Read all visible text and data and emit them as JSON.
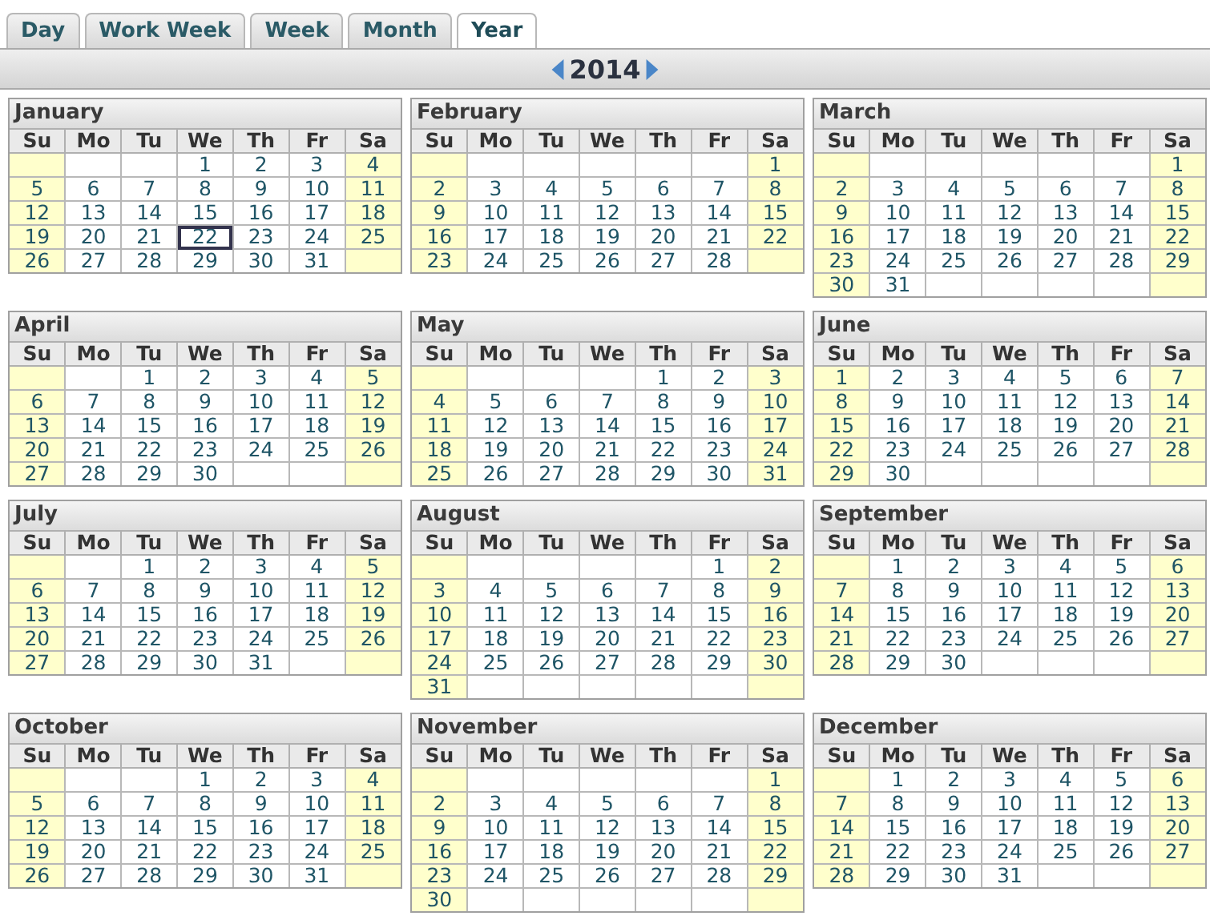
{
  "tabs": [
    {
      "label": "Day",
      "selected": false
    },
    {
      "label": "Work Week",
      "selected": false
    },
    {
      "label": "Week",
      "selected": false
    },
    {
      "label": "Month",
      "selected": false
    },
    {
      "label": "Year",
      "selected": true
    }
  ],
  "year": "2014",
  "months": [
    {
      "name": "January",
      "weekdays": [
        "Su",
        "Mo",
        "Tu",
        "We",
        "Th",
        "Fr",
        "Sa"
      ],
      "weeks": [
        [
          "1",
          "2",
          "3",
          "4"
        ],
        [
          "5",
          "6",
          "7",
          "8",
          "9",
          "10",
          "11"
        ],
        [
          "12",
          "13",
          "14",
          "15",
          "16",
          "17",
          "18"
        ],
        [
          "19",
          "20",
          "21",
          {
            "day": "22",
            "today": true
          },
          "23",
          "24",
          "25"
        ],
        [
          "26",
          "27",
          "28",
          "29",
          "30",
          "31"
        ]
      ]
    },
    {
      "name": "February",
      "weekdays": [
        "Su",
        "Mo",
        "Tu",
        "We",
        "Th",
        "Fr",
        "Sa"
      ],
      "weeks": [
        [
          "1"
        ],
        [
          "2",
          "3",
          "4",
          "5",
          "6",
          "7",
          "8"
        ],
        [
          "9",
          "10",
          "11",
          "12",
          "13",
          "14",
          "15"
        ],
        [
          "16",
          "17",
          "18",
          "19",
          "20",
          "21",
          "22"
        ],
        [
          "23",
          "24",
          "25",
          "26",
          "27",
          "28"
        ]
      ]
    },
    {
      "name": "March",
      "weekdays": [
        "Su",
        "Mo",
        "Tu",
        "We",
        "Th",
        "Fr",
        "Sa"
      ],
      "weeks": [
        [
          "1"
        ],
        [
          "2",
          "3",
          "4",
          "5",
          "6",
          "7",
          "8"
        ],
        [
          "9",
          "10",
          "11",
          "12",
          "13",
          "14",
          "15"
        ],
        [
          "16",
          "17",
          "18",
          "19",
          "20",
          "21",
          "22"
        ],
        [
          "23",
          "24",
          "25",
          "26",
          "27",
          "28",
          "29"
        ],
        [
          "30",
          "31"
        ]
      ]
    },
    {
      "name": "April",
      "weekdays": [
        "Su",
        "Mo",
        "Tu",
        "We",
        "Th",
        "Fr",
        "Sa"
      ],
      "weeks": [
        [
          "1",
          "2",
          "3",
          "4",
          "5"
        ],
        [
          "6",
          "7",
          "8",
          "9",
          "10",
          "11",
          "12"
        ],
        [
          "13",
          "14",
          "15",
          "16",
          "17",
          "18",
          "19"
        ],
        [
          "20",
          "21",
          "22",
          "23",
          "24",
          "25",
          "26"
        ],
        [
          "27",
          "28",
          "29",
          "30"
        ]
      ]
    },
    {
      "name": "May",
      "weekdays": [
        "Su",
        "Mo",
        "Tu",
        "We",
        "Th",
        "Fr",
        "Sa"
      ],
      "weeks": [
        [
          "1",
          "2",
          "3"
        ],
        [
          "4",
          "5",
          "6",
          "7",
          "8",
          "9",
          "10"
        ],
        [
          "11",
          "12",
          "13",
          "14",
          "15",
          "16",
          "17"
        ],
        [
          "18",
          "19",
          "20",
          "21",
          "22",
          "23",
          "24"
        ],
        [
          "25",
          "26",
          "27",
          "28",
          "29",
          "30",
          "31"
        ]
      ]
    },
    {
      "name": "June",
      "weekdays": [
        "Su",
        "Mo",
        "Tu",
        "We",
        "Th",
        "Fr",
        "Sa"
      ],
      "weeks": [
        [
          "1",
          "2",
          "3",
          "4",
          "5",
          "6",
          "7"
        ],
        [
          "8",
          "9",
          "10",
          "11",
          "12",
          "13",
          "14"
        ],
        [
          "15",
          "16",
          "17",
          "18",
          "19",
          "20",
          "21"
        ],
        [
          "22",
          "23",
          "24",
          "25",
          "26",
          "27",
          "28"
        ],
        [
          "29",
          "30"
        ]
      ]
    },
    {
      "name": "July",
      "weekdays": [
        "Su",
        "Mo",
        "Tu",
        "We",
        "Th",
        "Fr",
        "Sa"
      ],
      "weeks": [
        [
          "1",
          "2",
          "3",
          "4",
          "5"
        ],
        [
          "6",
          "7",
          "8",
          "9",
          "10",
          "11",
          "12"
        ],
        [
          "13",
          "14",
          "15",
          "16",
          "17",
          "18",
          "19"
        ],
        [
          "20",
          "21",
          "22",
          "23",
          "24",
          "25",
          "26"
        ],
        [
          "27",
          "28",
          "29",
          "30",
          "31"
        ]
      ]
    },
    {
      "name": "August",
      "weekdays": [
        "Su",
        "Mo",
        "Tu",
        "We",
        "Th",
        "Fr",
        "Sa"
      ],
      "weeks": [
        [
          "1",
          "2"
        ],
        [
          "3",
          "4",
          "5",
          "6",
          "7",
          "8",
          "9"
        ],
        [
          "10",
          "11",
          "12",
          "13",
          "14",
          "15",
          "16"
        ],
        [
          "17",
          "18",
          "19",
          "20",
          "21",
          "22",
          "23"
        ],
        [
          "24",
          "25",
          "26",
          "27",
          "28",
          "29",
          "30"
        ],
        [
          "31"
        ]
      ]
    },
    {
      "name": "September",
      "weekdays": [
        "Su",
        "Mo",
        "Tu",
        "We",
        "Th",
        "Fr",
        "Sa"
      ],
      "weeks": [
        [
          "1",
          "2",
          "3",
          "4",
          "5",
          "6"
        ],
        [
          "7",
          "8",
          "9",
          "10",
          "11",
          "12",
          "13"
        ],
        [
          "14",
          "15",
          "16",
          "17",
          "18",
          "19",
          "20"
        ],
        [
          "21",
          "22",
          "23",
          "24",
          "25",
          "26",
          "27"
        ],
        [
          "28",
          "29",
          "30"
        ]
      ]
    },
    {
      "name": "October",
      "weekdays": [
        "Su",
        "Mo",
        "Tu",
        "We",
        "Th",
        "Fr",
        "Sa"
      ],
      "weeks": [
        [
          "1",
          "2",
          "3",
          "4"
        ],
        [
          "5",
          "6",
          "7",
          "8",
          "9",
          "10",
          "11"
        ],
        [
          "12",
          "13",
          "14",
          "15",
          "16",
          "17",
          "18"
        ],
        [
          "19",
          "20",
          "21",
          "22",
          "23",
          "24",
          "25"
        ],
        [
          "26",
          "27",
          "28",
          "29",
          "30",
          "31"
        ]
      ]
    },
    {
      "name": "November",
      "weekdays": [
        "Su",
        "Mo",
        "Tu",
        "We",
        "Th",
        "Fr",
        "Sa"
      ],
      "weeks": [
        [
          "1"
        ],
        [
          "2",
          "3",
          "4",
          "5",
          "6",
          "7",
          "8"
        ],
        [
          "9",
          "10",
          "11",
          "12",
          "13",
          "14",
          "15"
        ],
        [
          "16",
          "17",
          "18",
          "19",
          "20",
          "21",
          "22"
        ],
        [
          "23",
          "24",
          "25",
          "26",
          "27",
          "28",
          "29"
        ],
        [
          "30"
        ]
      ]
    },
    {
      "name": "December",
      "weekdays": [
        "Su",
        "Mo",
        "Tu",
        "We",
        "Th",
        "Fr",
        "Sa"
      ],
      "weeks": [
        [
          "1",
          "2",
          "3",
          "4",
          "5",
          "6"
        ],
        [
          "7",
          "8",
          "9",
          "10",
          "11",
          "12",
          "13"
        ],
        [
          "14",
          "15",
          "16",
          "17",
          "18",
          "19",
          "20"
        ],
        [
          "21",
          "22",
          "23",
          "24",
          "25",
          "26",
          "27"
        ],
        [
          "28",
          "29",
          "30",
          "31"
        ]
      ]
    }
  ]
}
